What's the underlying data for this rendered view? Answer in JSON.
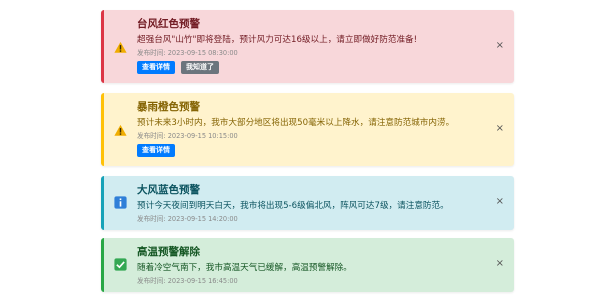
{
  "alerts": [
    {
      "title": "台风红色预警",
      "message": "超强台风\"山竹\"即将登陆，预计风力可达16级以上，请立即做好防范准备!",
      "time": "发布时间: 2023-09-15 08:30:00",
      "buttons": [
        "查看详情",
        "我知道了"
      ],
      "icon": "warning-triangle-icon",
      "accent": "#dc3545"
    },
    {
      "title": "暴雨橙色预警",
      "message": "预计未来3小时内，我市大部分地区将出现50毫米以上降水，请注意防范城市内涝。",
      "time": "发布时间: 2023-09-15 10:15:00",
      "buttons": [
        "查看详情"
      ],
      "icon": "warning-triangle-icon",
      "accent": "#ffc107"
    },
    {
      "title": "大风蓝色预警",
      "message": "预计今天夜间到明天白天，我市将出现5-6级偏北风，阵风可达7级，请注意防范。",
      "time": "发布时间: 2023-09-15 14:20:00",
      "buttons": [],
      "icon": "info-icon",
      "accent": "#17a2b8"
    },
    {
      "title": "高温预警解除",
      "message": "随着冷空气南下，我市高温天气已缓解，高温预警解除。",
      "time": "发布时间: 2023-09-15 16:45:00",
      "buttons": [],
      "icon": "check-icon",
      "accent": "#28a745"
    }
  ],
  "close_label": "×"
}
